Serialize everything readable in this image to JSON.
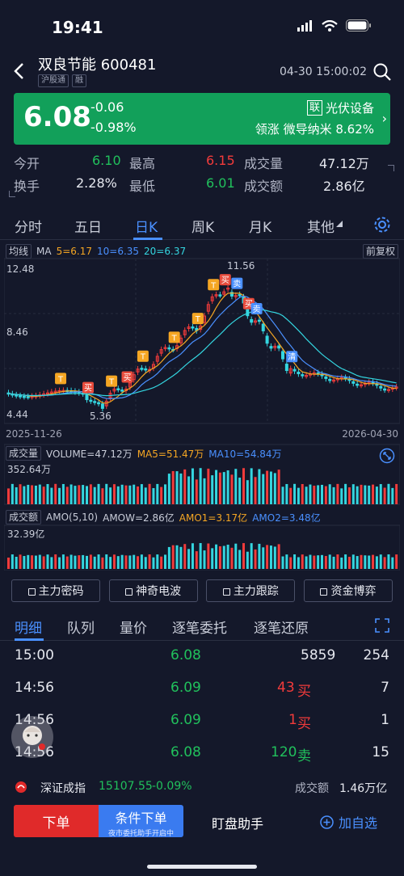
{
  "status": {
    "time": "19:41"
  },
  "header": {
    "stock_name": "双良节能 600481",
    "tags": [
      "沪股通",
      "融"
    ],
    "datetime": "04-30 15:00:02"
  },
  "price_card": {
    "price": "6.08",
    "change": "-0.06",
    "change_pct": "-0.98%",
    "sector_badge": "联",
    "sector": "光伏设备",
    "lead": "领涨 微导纳米 8.62%",
    "bg_color": "#12a05a"
  },
  "quote": {
    "row1": {
      "open_label": "今开",
      "open": "6.10",
      "high_label": "最高",
      "high": "6.15",
      "vol_label": "成交量",
      "vol": "47.12万"
    },
    "row2": {
      "turnover_label": "换手",
      "turnover": "2.28%",
      "low_label": "最低",
      "low": "6.01",
      "amt_label": "成交额",
      "amt": "2.86亿"
    }
  },
  "chart_tabs": [
    "分时",
    "五日",
    "日K",
    "周K",
    "月K",
    "其他"
  ],
  "chart": {
    "ma_select": "均线",
    "ma_label": "MA",
    "ma5": "5=6.17",
    "ma10": "10=6.35",
    "ma20": "20=6.37",
    "adjust": "前复权",
    "y_top": "12.48",
    "y_mid": "8.46",
    "y_bot": "4.44",
    "high_mark": "11.56",
    "low_mark": "5.36",
    "date_start": "2025-11-26",
    "date_end": "2026-04-30",
    "vol_select": "成交量",
    "vol_label": "VOLUME=47.12万",
    "vol_ma5": "MA5=51.47万",
    "vol_ma10": "MA10=54.84万",
    "vol_max": "352.64万",
    "amt_select": "成交额",
    "amt_label": "AMO(5,10)",
    "amow": "AMOW=2.86亿",
    "amo1": "AMO1=3.17亿",
    "amo2": "AMO2=3.48亿",
    "amt_max": "32.39亿",
    "colors": {
      "ma5": "#f5a623",
      "ma10": "#4a90ff",
      "ma20": "#34d6e0",
      "up": "#f23b3b",
      "down": "#34d6e0"
    }
  },
  "chart_data": {
    "type": "candlestick",
    "x_range": [
      "2025-11-26",
      "2026-04-30"
    ],
    "y_range": [
      4.44,
      12.48
    ],
    "annotated_high": 11.56,
    "annotated_low": 5.36,
    "last_close": 6.08
  },
  "tools": [
    "主力密码",
    "神奇电波",
    "主力跟踪",
    "资金博弈"
  ],
  "detail_tabs": [
    "明细",
    "队列",
    "量价",
    "逐笔委托",
    "逐笔还原"
  ],
  "trades": [
    {
      "time": "15:00",
      "price": "6.08",
      "vol": "5859",
      "side": "",
      "count": "254"
    },
    {
      "time": "14:56",
      "price": "6.09",
      "vol": "43",
      "side": "买",
      "count": "7"
    },
    {
      "time": "14:56",
      "price": "6.09",
      "vol": "1",
      "side": "买",
      "count": "1"
    },
    {
      "time": "14:56",
      "price": "6.08",
      "vol": "120",
      "side": "卖",
      "count": "15"
    }
  ],
  "index": {
    "name": "深证成指",
    "value": "15107.55",
    "pct": "-0.09%",
    "amt_label": "成交额",
    "amt": "1.46万亿"
  },
  "bottom": {
    "order": "下单",
    "cond_order": "条件下单",
    "cond_sub": "夜市委托助手开启中",
    "assistant": "盯盘助手",
    "watchlist": "加自选"
  }
}
